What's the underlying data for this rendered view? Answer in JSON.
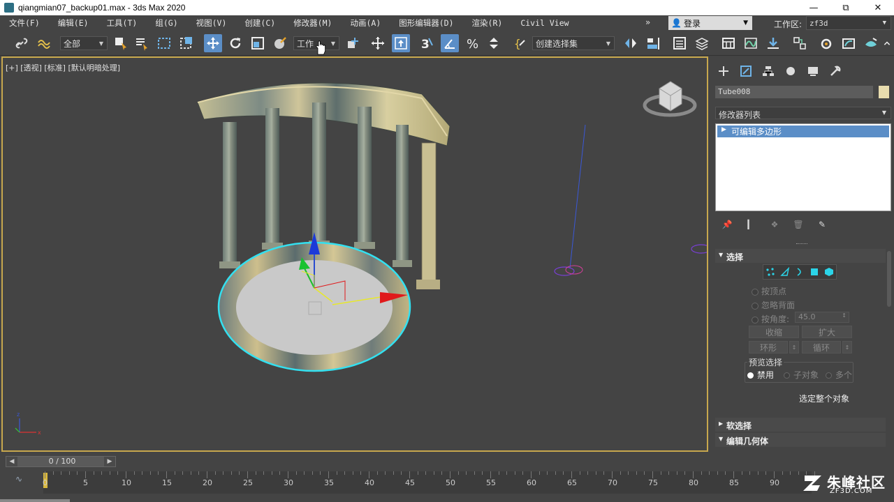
{
  "window": {
    "title": "qiangmian07_backup01.max - 3ds Max 2020",
    "controls": [
      "minimize",
      "maximize",
      "close"
    ]
  },
  "menubar": {
    "items": [
      "文件(F)",
      "编辑(E)",
      "工具(T)",
      "组(G)",
      "视图(V)",
      "创建(C)",
      "修改器(M)",
      "动画(A)",
      "图形编辑器(D)",
      "渲染(R)",
      "Civil View"
    ],
    "overflow": "»",
    "login_label": "登录",
    "workspace_label": "工作区:",
    "workspace_value": "zf3d"
  },
  "toolbar": {
    "selection_filter": "全部",
    "coordinate_system": "工作",
    "named_selection_sets": "创建选择集"
  },
  "viewport": {
    "label": "[+] [透视] [标准] [默认明暗处理]",
    "accent_border": "#c8a84d",
    "selection_color": "#33e0f0"
  },
  "command_panel": {
    "object_name": "Tube008",
    "object_color": "#e8dcae",
    "modifier_list_label": "修改器列表",
    "modifier_stack": [
      "可编辑多边形"
    ],
    "rollouts": {
      "selection": {
        "title": "选择",
        "by_vertex": "按顶点",
        "ignore_backfacing": "忽略背面",
        "by_angle": "按角度:",
        "angle_value": "45.0",
        "shrink": "收缩",
        "grow": "扩大",
        "ring": "环形",
        "loop": "循环",
        "preview_title": "预览选择",
        "preview_disabled": "禁用",
        "preview_subobject": "子对象",
        "preview_multi": "多个",
        "status": "选定整个对象"
      },
      "soft_selection": "软选择",
      "edit_geometry": "编辑几何体"
    }
  },
  "timeline": {
    "frame_display": "0 / 100",
    "tick_labels": [
      "0",
      "5",
      "10",
      "15",
      "20",
      "25",
      "30",
      "35",
      "40",
      "45",
      "50",
      "55",
      "60",
      "65",
      "70",
      "75",
      "80",
      "85",
      "90"
    ]
  },
  "watermark": {
    "brand": "朱峰社区",
    "url": "ZF3D.COM"
  }
}
